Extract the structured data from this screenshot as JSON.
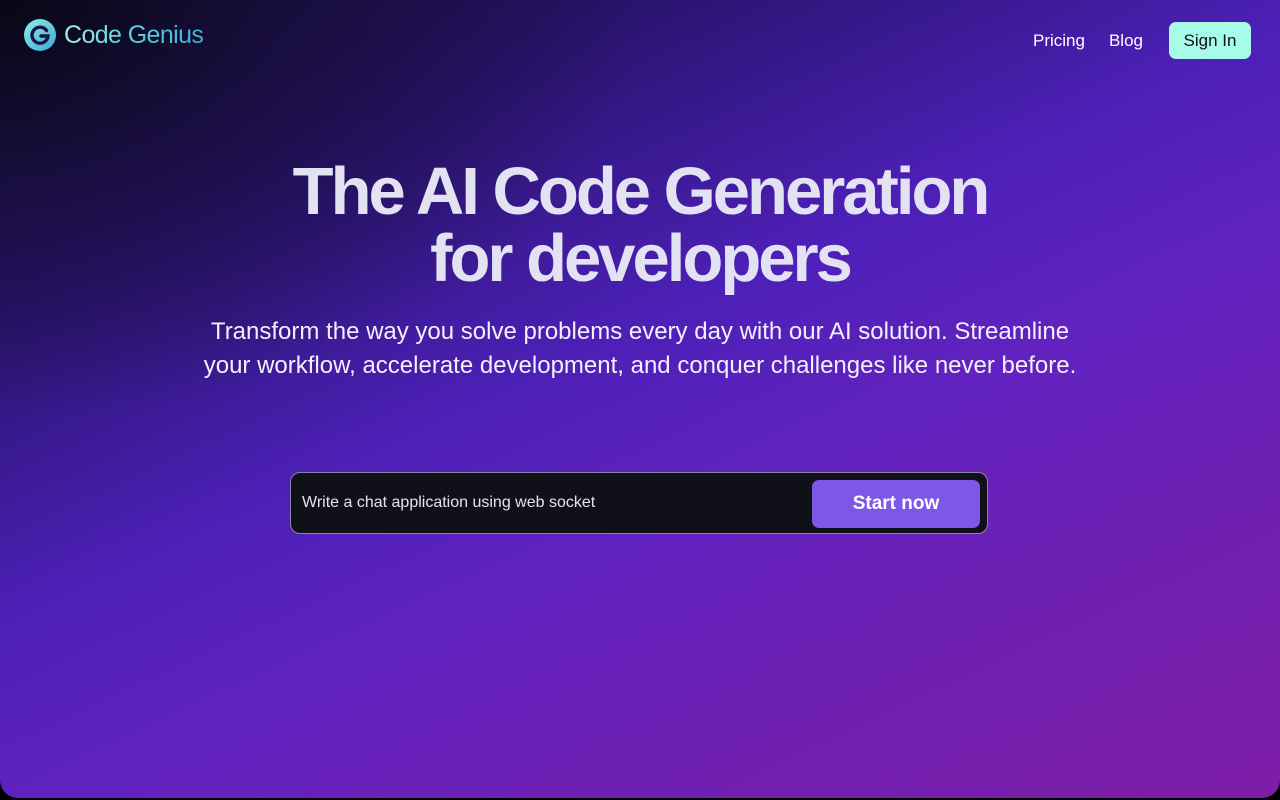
{
  "brand": {
    "name": "Code Genius",
    "logo_icon": "code-genius-logo-icon",
    "logo_letter": "G"
  },
  "nav": {
    "links": [
      "Pricing",
      "Blog"
    ],
    "signin_label": "Sign In"
  },
  "hero": {
    "title_line1": "The AI Code Generation",
    "title_line2": "for developers",
    "subtitle": "Transform the way you solve problems every day with our AI solution. Streamline your workflow, accelerate development, and conquer challenges like never before."
  },
  "prompt": {
    "value": "Write a chat application using web socket",
    "placeholder": "",
    "submit_label": "Start now"
  },
  "colors": {
    "accent_mint": "#a7fce8",
    "button_purple": "#7f57e6",
    "brand_gradient_start": "#9ef2e6",
    "brand_gradient_end": "#3fb2d6",
    "input_background": "#101018"
  }
}
